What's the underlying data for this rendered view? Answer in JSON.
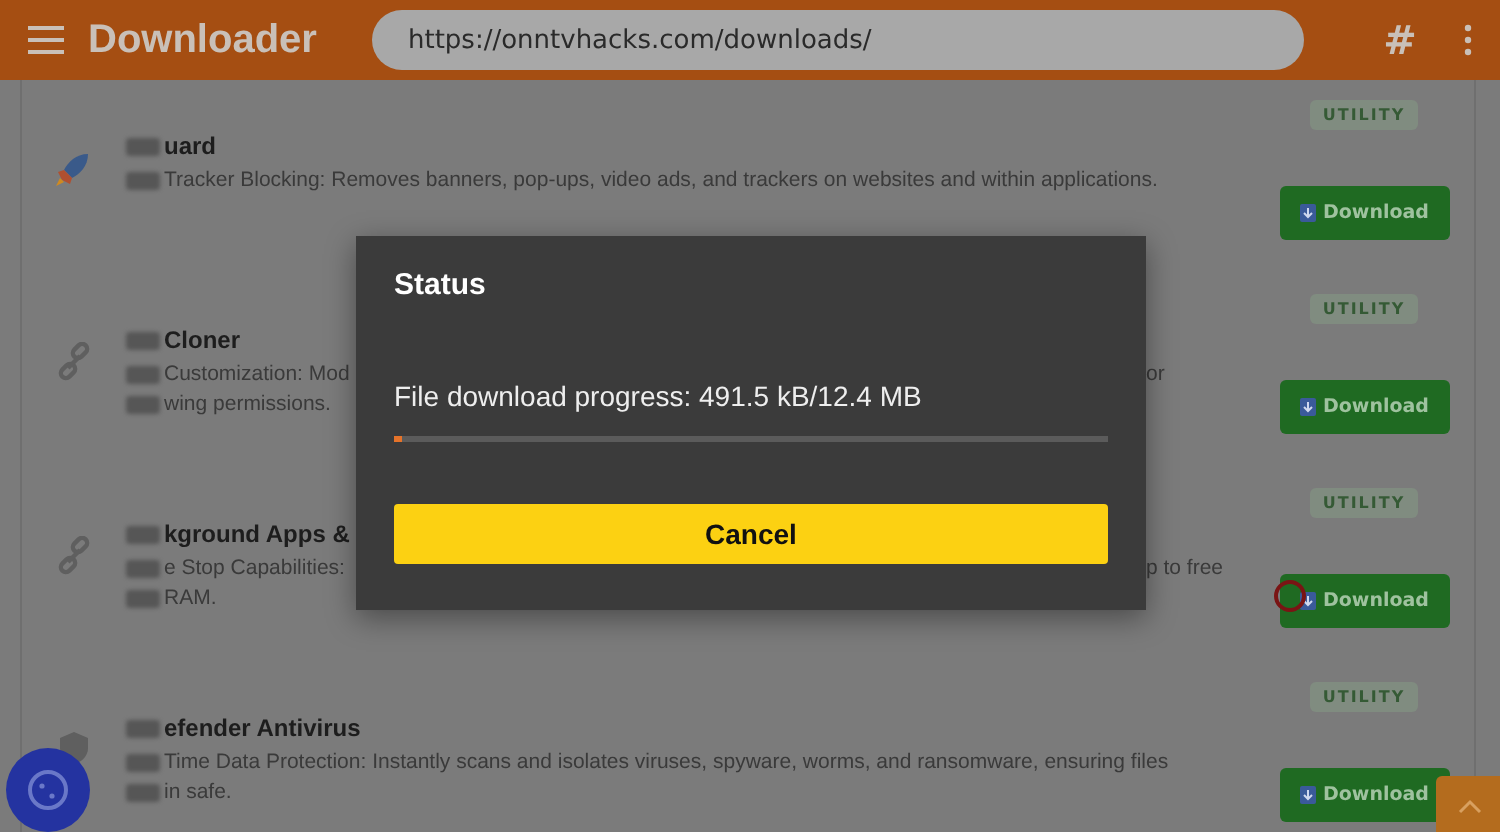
{
  "header": {
    "app_name": "Downloader",
    "url": "https://onntvhacks.com/downloads/",
    "hash": "#"
  },
  "apps": [
    {
      "kind": "rocket",
      "title": "uard",
      "badge": "UTILITY",
      "button": "Download",
      "lines": [
        {
          "left": "Tracker Blocking: Removes banners, pop-ups, video ads, and trackers on websites and within applications."
        }
      ]
    },
    {
      "kind": "link",
      "title": "Cloner",
      "badge": "UTILITY",
      "button": "Download",
      "lines": [
        {
          "left": "Customization: Mod",
          "right": "or"
        },
        {
          "left": "wing permissions."
        }
      ]
    },
    {
      "kind": "link",
      "title": "kground Apps &",
      "badge": "UTILITY",
      "button": "Download",
      "lines": [
        {
          "left": "e Stop Capabilities: ",
          "right": "p to free"
        },
        {
          "left": "RAM."
        }
      ]
    },
    {
      "kind": "shield",
      "title": "efender Antivirus",
      "badge": "UTILITY",
      "button": "Download",
      "lines": [
        {
          "left": "Time Data Protection: Instantly scans and isolates viruses, spyware, worms, and ransomware, ensuring files"
        },
        {
          "left": "in safe."
        }
      ]
    }
  ],
  "dialog": {
    "title": "Status",
    "progress_label": "File download progress: 491.5 kB/12.4 MB",
    "level": 0.01,
    "cancel": "Cancel"
  }
}
